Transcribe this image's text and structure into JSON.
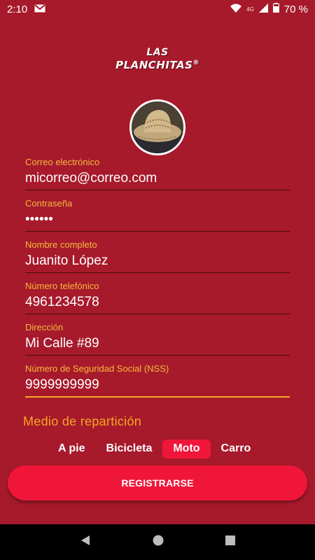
{
  "status_bar": {
    "time": "2:10",
    "network": "4G",
    "battery": "70 %",
    "icons": [
      "gmail-icon",
      "wifi-icon",
      "signal-icon",
      "battery-icon"
    ]
  },
  "logo": {
    "line1": "LAS",
    "line2": "PLANCHITAS",
    "mark": "®"
  },
  "avatar": {
    "icon": "profile-photo-straw-hat"
  },
  "form": {
    "fields": [
      {
        "label": "Correo electrónico",
        "value": "micorreo@correo.com"
      },
      {
        "label": "Contraseña",
        "value": "••••••"
      },
      {
        "label": "Nombre completo",
        "value": "Juanito López"
      },
      {
        "label": "Número telefónico",
        "value": "4961234578"
      },
      {
        "label": "Dirección",
        "value": "Mi Calle #89"
      },
      {
        "label": "Número de Seguridad Social (NSS)",
        "value": "9999999999"
      }
    ]
  },
  "delivery": {
    "label": "Medio de repartición",
    "options": [
      "A pie",
      "Bicicleta",
      "Moto",
      "Carro"
    ],
    "selected": "Moto"
  },
  "register_label": "REGISTRARSE",
  "nav_bar": {
    "icons": [
      "back-icon",
      "home-icon",
      "recents-icon"
    ]
  },
  "colors": {
    "background": "#A71A2B",
    "accent": "#F0163A",
    "label": "#F6B93B",
    "underline_active": "#F6A623"
  }
}
